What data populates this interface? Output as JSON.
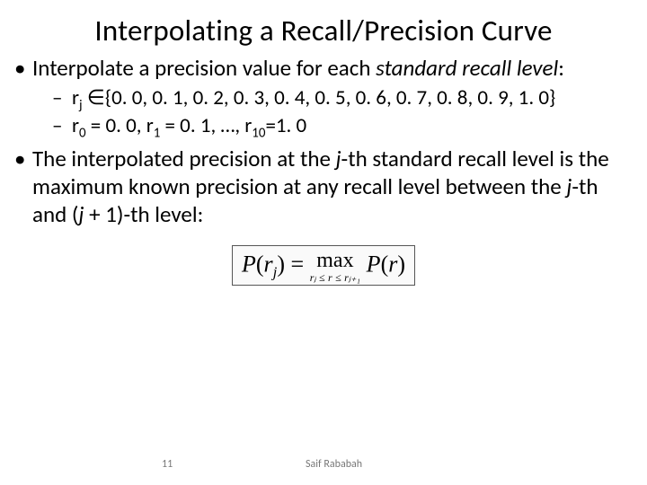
{
  "title": "Interpolating a Recall/Precision Curve",
  "bullets": {
    "b1_pre": "Interpolate a precision value for each ",
    "b1_em": "standard recall level",
    "b1_post": ":",
    "s1_pre": "r",
    "s1_sub": "j",
    "s1_post": " ∈{0. 0, 0. 1, 0. 2, 0. 3, 0. 4, 0. 5, 0. 6, 0. 7, 0. 8, 0. 9, 1. 0}",
    "s2_a": "r",
    "s2_a_sub": "0",
    "s2_b": " = 0. 0, r",
    "s2_b_sub": "1",
    "s2_c": " = 0. 1, …, r",
    "s2_c_sub": "10",
    "s2_d": "=1. 0",
    "b2_a": "The interpolated precision at the ",
    "b2_j1": "j",
    "b2_b": "-th standard recall level is the maximum known precision at any recall level between the ",
    "b2_j2": "j",
    "b2_c": "-th and (",
    "b2_j3": "j",
    "b2_d": " + 1)-th level:"
  },
  "formula": {
    "lhs_P": "P",
    "lhs_open": "(",
    "lhs_r": "r",
    "lhs_j": "j",
    "lhs_close": ")",
    "eq": " = ",
    "max": "max",
    "cond": "rⱼ ≤ r ≤ rⱼ₊₁",
    "rhs_P": " P",
    "rhs_open": "(",
    "rhs_r": "r",
    "rhs_close": ")"
  },
  "footer": {
    "page": "11",
    "author": "Saif Rababah"
  }
}
